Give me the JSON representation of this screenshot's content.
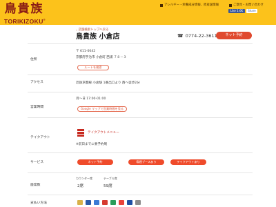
{
  "header": {
    "logo_chars": [
      "鳥",
      "貴",
      "族"
    ],
    "logo_en": "TORIKIZOKU",
    "logo_mark": "®",
    "allergy_link": "アレルギー・栄養成分情報、原産国情報",
    "contact_link": "ご意見・お問い合わせ",
    "fb_like": "Like 1.6K",
    "fb_share": "Share"
  },
  "breadcrumb": "店舗検索トップへ戻る",
  "store": {
    "name": "鳥貴族 小倉店",
    "phone": "0774-22-3611",
    "reserve_label": "ネット予約"
  },
  "rows": {
    "address": {
      "label": "住所",
      "postal": "〒 611-0042",
      "address": "京都府宇治市 小倉町 西浦 ７８－３",
      "route_button": "ルートを検索"
    },
    "access": {
      "label": "アクセス",
      "text": "近鉄京都線 小倉駅 1番出口より 西へ徒歩2分"
    },
    "hours": {
      "label": "営業時間",
      "text": "月〜日 17:00-01:00",
      "google_button": "Google マップで営業時間を見る"
    },
    "takeout": {
      "label": "テイクアウト",
      "menu_link": "テイクアウトメニュー",
      "note": "※前日までに要予約制"
    },
    "service": {
      "label": "サービス",
      "pills": [
        "ネット予約",
        "喫煙ブースあり",
        "テイクアウトあり"
      ]
    },
    "seats": {
      "label": "座席数",
      "counter_label": "カウンター席",
      "counter_value": "2席",
      "table_label": "テーブル席",
      "table_value": "59席"
    },
    "payment": {
      "label": "支払い方法"
    }
  },
  "colors": {
    "header_bg": "#fcc21b",
    "brand": "#8a1c16",
    "accent": "#e04a2f"
  }
}
